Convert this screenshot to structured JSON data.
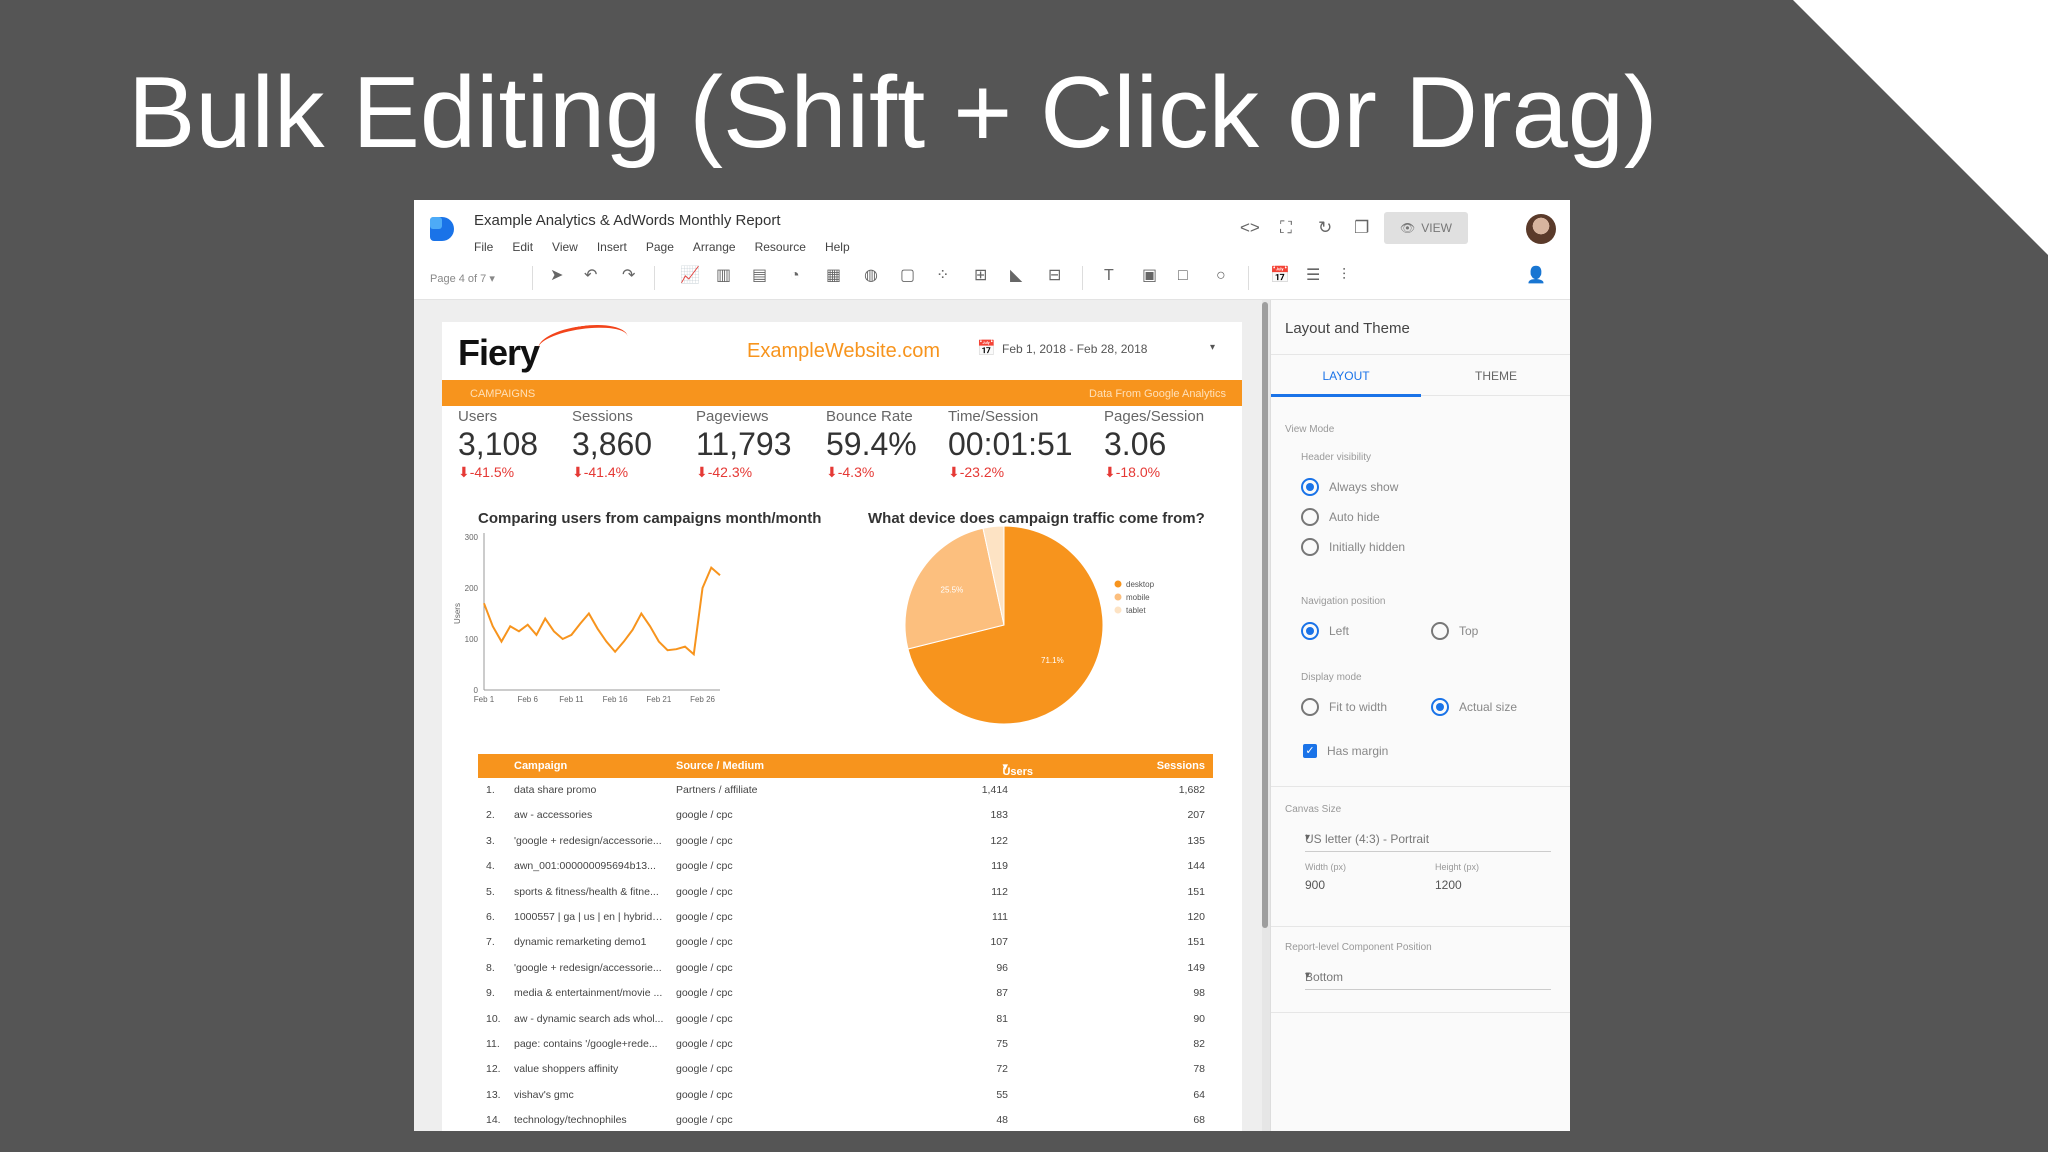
{
  "slide": {
    "title": "Bulk Editing (Shift + Click or Drag)"
  },
  "app": {
    "doc_title": "Example Analytics & AdWords Monthly Report",
    "menu": [
      "File",
      "Edit",
      "View",
      "Insert",
      "Page",
      "Arrange",
      "Resource",
      "Help"
    ],
    "view_label": "VIEW",
    "page_selector": "Page 4 of 7",
    "icons": {
      "code": "code-icon",
      "fullscreen": "fullscreen-icon",
      "refresh": "refresh-icon",
      "copy": "copy-icon",
      "eye": "eye-icon",
      "share": "add-person-icon"
    }
  },
  "report": {
    "brand": "Fiery",
    "website": "ExampleWebsite.com",
    "date_range": "Feb 1, 2018 - Feb 28, 2018",
    "banner_left": "CAMPAIGNS",
    "banner_right": "Data From Google Analytics",
    "kpis": [
      {
        "label": "Users",
        "value": "3,108",
        "change": "-41.5%"
      },
      {
        "label": "Sessions",
        "value": "3,860",
        "change": "-41.4%"
      },
      {
        "label": "Pageviews",
        "value": "11,793",
        "change": "-42.3%"
      },
      {
        "label": "Bounce Rate",
        "value": "59.4%",
        "change": "-4.3%"
      },
      {
        "label": "Time/Session",
        "value": "00:01:51",
        "change": "-23.2%"
      },
      {
        "label": "Pages/Session",
        "value": "3.06",
        "change": "-18.0%"
      }
    ],
    "line_chart_title": "Comparing users from campaigns month/month",
    "pie_chart_title": "What device does campaign traffic come from?",
    "table": {
      "headers": {
        "campaign": "Campaign",
        "source": "Source / Medium",
        "users": "Users",
        "sessions": "Sessions"
      },
      "rows": [
        {
          "n": "1.",
          "campaign": "data share promo",
          "source": "Partners / affiliate",
          "users": "1,414",
          "sessions": "1,682"
        },
        {
          "n": "2.",
          "campaign": "aw - accessories",
          "source": "google / cpc",
          "users": "183",
          "sessions": "207"
        },
        {
          "n": "3.",
          "campaign": "'google + redesign/accessorie...",
          "source": "google / cpc",
          "users": "122",
          "sessions": "135"
        },
        {
          "n": "4.",
          "campaign": "awn_001:000000095694b13...",
          "source": "google / cpc",
          "users": "119",
          "sessions": "144"
        },
        {
          "n": "5.",
          "campaign": "sports & fitness/health & fitne...",
          "source": "google / cpc",
          "users": "112",
          "sessions": "151"
        },
        {
          "n": "6.",
          "campaign": "1000557 | ga | us | en | hybrid |...",
          "source": "google / cpc",
          "users": "111",
          "sessions": "120"
        },
        {
          "n": "7.",
          "campaign": "dynamic remarketing demo1",
          "source": "google / cpc",
          "users": "107",
          "sessions": "151"
        },
        {
          "n": "8.",
          "campaign": "'google + redesign/accessorie...",
          "source": "google / cpc",
          "users": "96",
          "sessions": "149"
        },
        {
          "n": "9.",
          "campaign": "media & entertainment/movie ...",
          "source": "google / cpc",
          "users": "87",
          "sessions": "98"
        },
        {
          "n": "10.",
          "campaign": "aw - dynamic search ads whol...",
          "source": "google / cpc",
          "users": "81",
          "sessions": "90"
        },
        {
          "n": "11.",
          "campaign": "page: contains '/google+rede...",
          "source": "google / cpc",
          "users": "75",
          "sessions": "82"
        },
        {
          "n": "12.",
          "campaign": "value shoppers affinity",
          "source": "google / cpc",
          "users": "72",
          "sessions": "78"
        },
        {
          "n": "13.",
          "campaign": "vishav's gmc",
          "source": "google / cpc",
          "users": "55",
          "sessions": "64"
        },
        {
          "n": "14.",
          "campaign": "technology/technophiles",
          "source": "google / cpc",
          "users": "48",
          "sessions": "68"
        }
      ]
    }
  },
  "panel": {
    "title": "Layout and Theme",
    "tabs": [
      "LAYOUT",
      "THEME"
    ],
    "view_mode": "View Mode",
    "header_visibility": "Header visibility",
    "header_options": [
      "Always show",
      "Auto hide",
      "Initially hidden"
    ],
    "nav_position": "Navigation position",
    "nav_options": [
      "Left",
      "Top"
    ],
    "display_mode": "Display mode",
    "display_options": [
      "Fit to width",
      "Actual size"
    ],
    "has_margin": "Has margin",
    "canvas_size": "Canvas Size",
    "canvas_value": "US letter (4:3) - Portrait",
    "width_label": "Width (px)",
    "width_value": "900",
    "height_label": "Height (px)",
    "height_value": "1200",
    "component_position": "Report-level Component Position",
    "component_value": "Bottom"
  },
  "chart_data": [
    {
      "type": "line",
      "title": "Comparing users from campaigns month/month",
      "ylabel": "Users",
      "ylim": [
        0,
        300
      ],
      "yticks": [
        0,
        100,
        200,
        300
      ],
      "xtick_labels": [
        "Feb 1",
        "Feb 6",
        "Feb 11",
        "Feb 16",
        "Feb 21",
        "Feb 26"
      ],
      "x": [
        1,
        2,
        3,
        4,
        5,
        6,
        7,
        8,
        9,
        10,
        11,
        12,
        13,
        14,
        15,
        16,
        17,
        18,
        19,
        20,
        21,
        22,
        23,
        24,
        25,
        26,
        27,
        28
      ],
      "values": [
        170,
        125,
        95,
        125,
        115,
        128,
        108,
        140,
        115,
        100,
        108,
        130,
        150,
        120,
        95,
        75,
        95,
        118,
        150,
        125,
        95,
        78,
        80,
        85,
        70,
        200,
        240,
        225
      ],
      "color": "#f7941d"
    },
    {
      "type": "pie",
      "title": "What device does campaign traffic come from?",
      "labels": [
        "desktop",
        "mobile",
        "tablet"
      ],
      "values": [
        71.1,
        25.5,
        3.4
      ],
      "data_labels": [
        "71.1%",
        "25.5%",
        ""
      ],
      "colors": [
        "#f7941d",
        "#fcbf7e",
        "#fde3c4"
      ],
      "legend": "right"
    }
  ]
}
